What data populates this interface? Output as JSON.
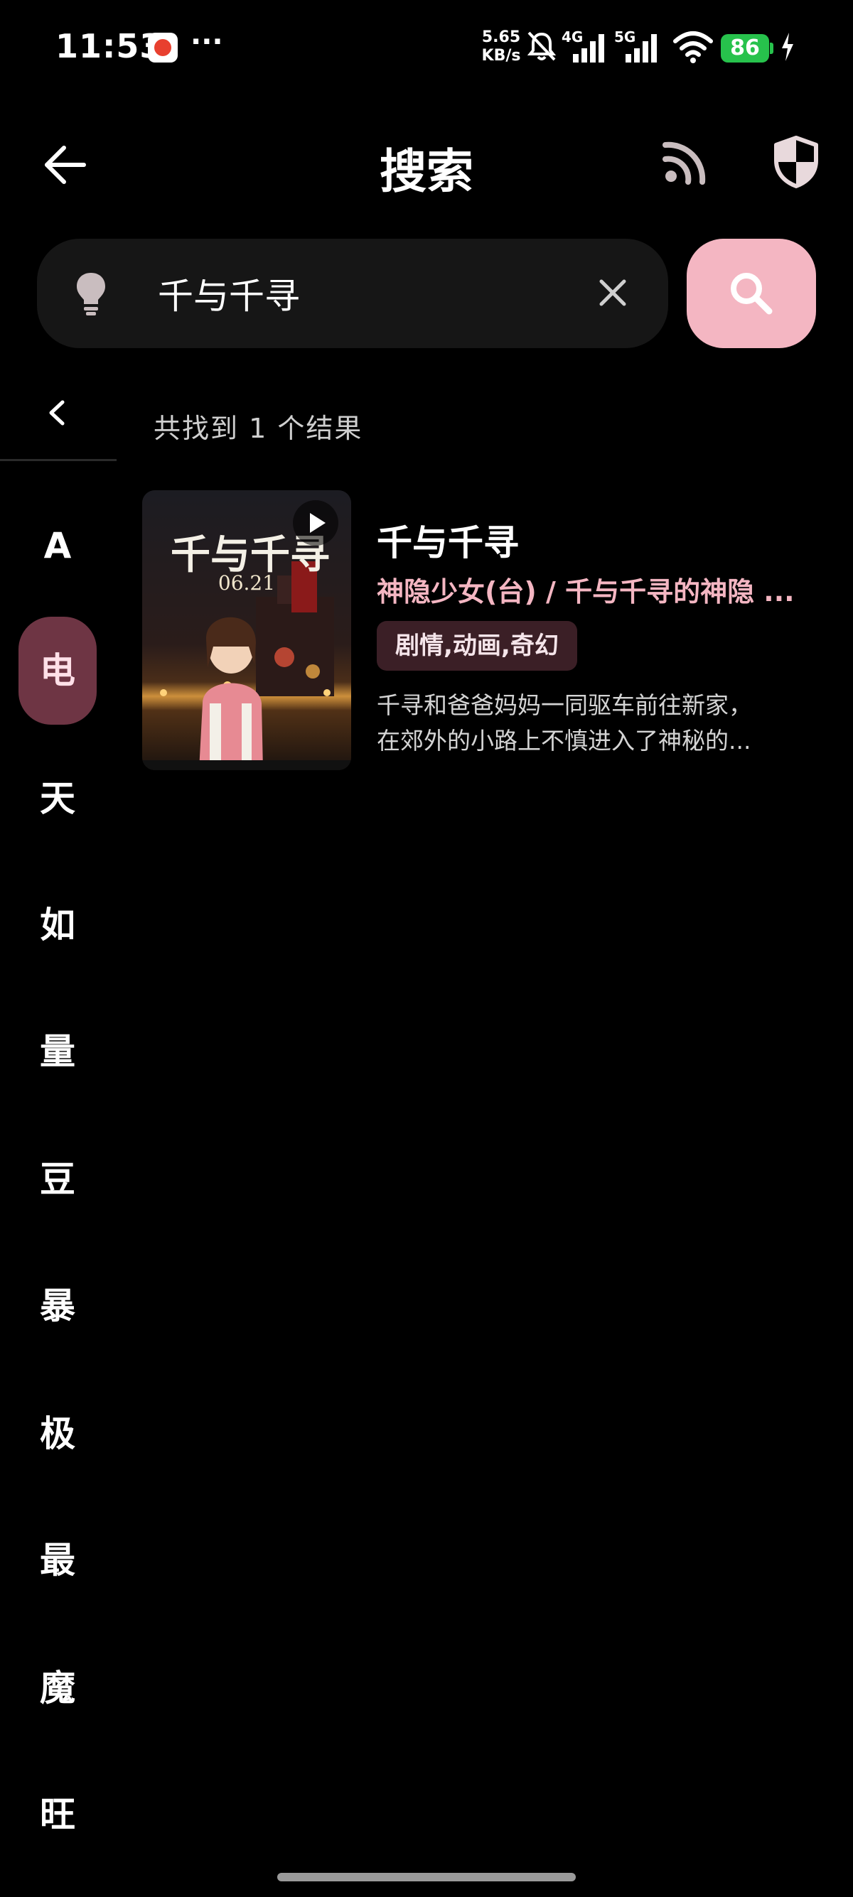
{
  "status_bar": {
    "time": "11:53",
    "net_speed_value": "5.65",
    "net_speed_unit": "KB/s",
    "signal_1_label": "4G",
    "signal_2_label": "5G",
    "battery": "86",
    "more": "···"
  },
  "header": {
    "title": "搜索"
  },
  "search": {
    "query": "千与千寻",
    "placeholder": ""
  },
  "sidebar": {
    "items": [
      {
        "label": "A",
        "active": false
      },
      {
        "label": "电",
        "active": true
      },
      {
        "label": "天",
        "active": false
      },
      {
        "label": "如",
        "active": false
      },
      {
        "label": "量",
        "active": false
      },
      {
        "label": "豆",
        "active": false
      },
      {
        "label": "暴",
        "active": false
      },
      {
        "label": "极",
        "active": false
      },
      {
        "label": "最",
        "active": false
      },
      {
        "label": "魔",
        "active": false
      },
      {
        "label": "旺",
        "active": false
      }
    ]
  },
  "results": {
    "count_text": "共找到 1 个结果",
    "items": [
      {
        "title": "千与千寻",
        "alias": "神隐少女(台) / 千与千寻的神隐 ...",
        "genres": "剧情,动画,奇幻",
        "description_line1": "千寻和爸爸妈妈一同驱车前往新家，",
        "description_line2": "在郊外的小路上不慎进入了神秘的...",
        "poster_title": "千与千寻",
        "poster_date": "06.21"
      }
    ]
  },
  "colors": {
    "accent": "#f4b6c2",
    "active_tab_bg": "#6e3544",
    "genre_bg": "#3b1f26",
    "battery": "#27c24c"
  }
}
